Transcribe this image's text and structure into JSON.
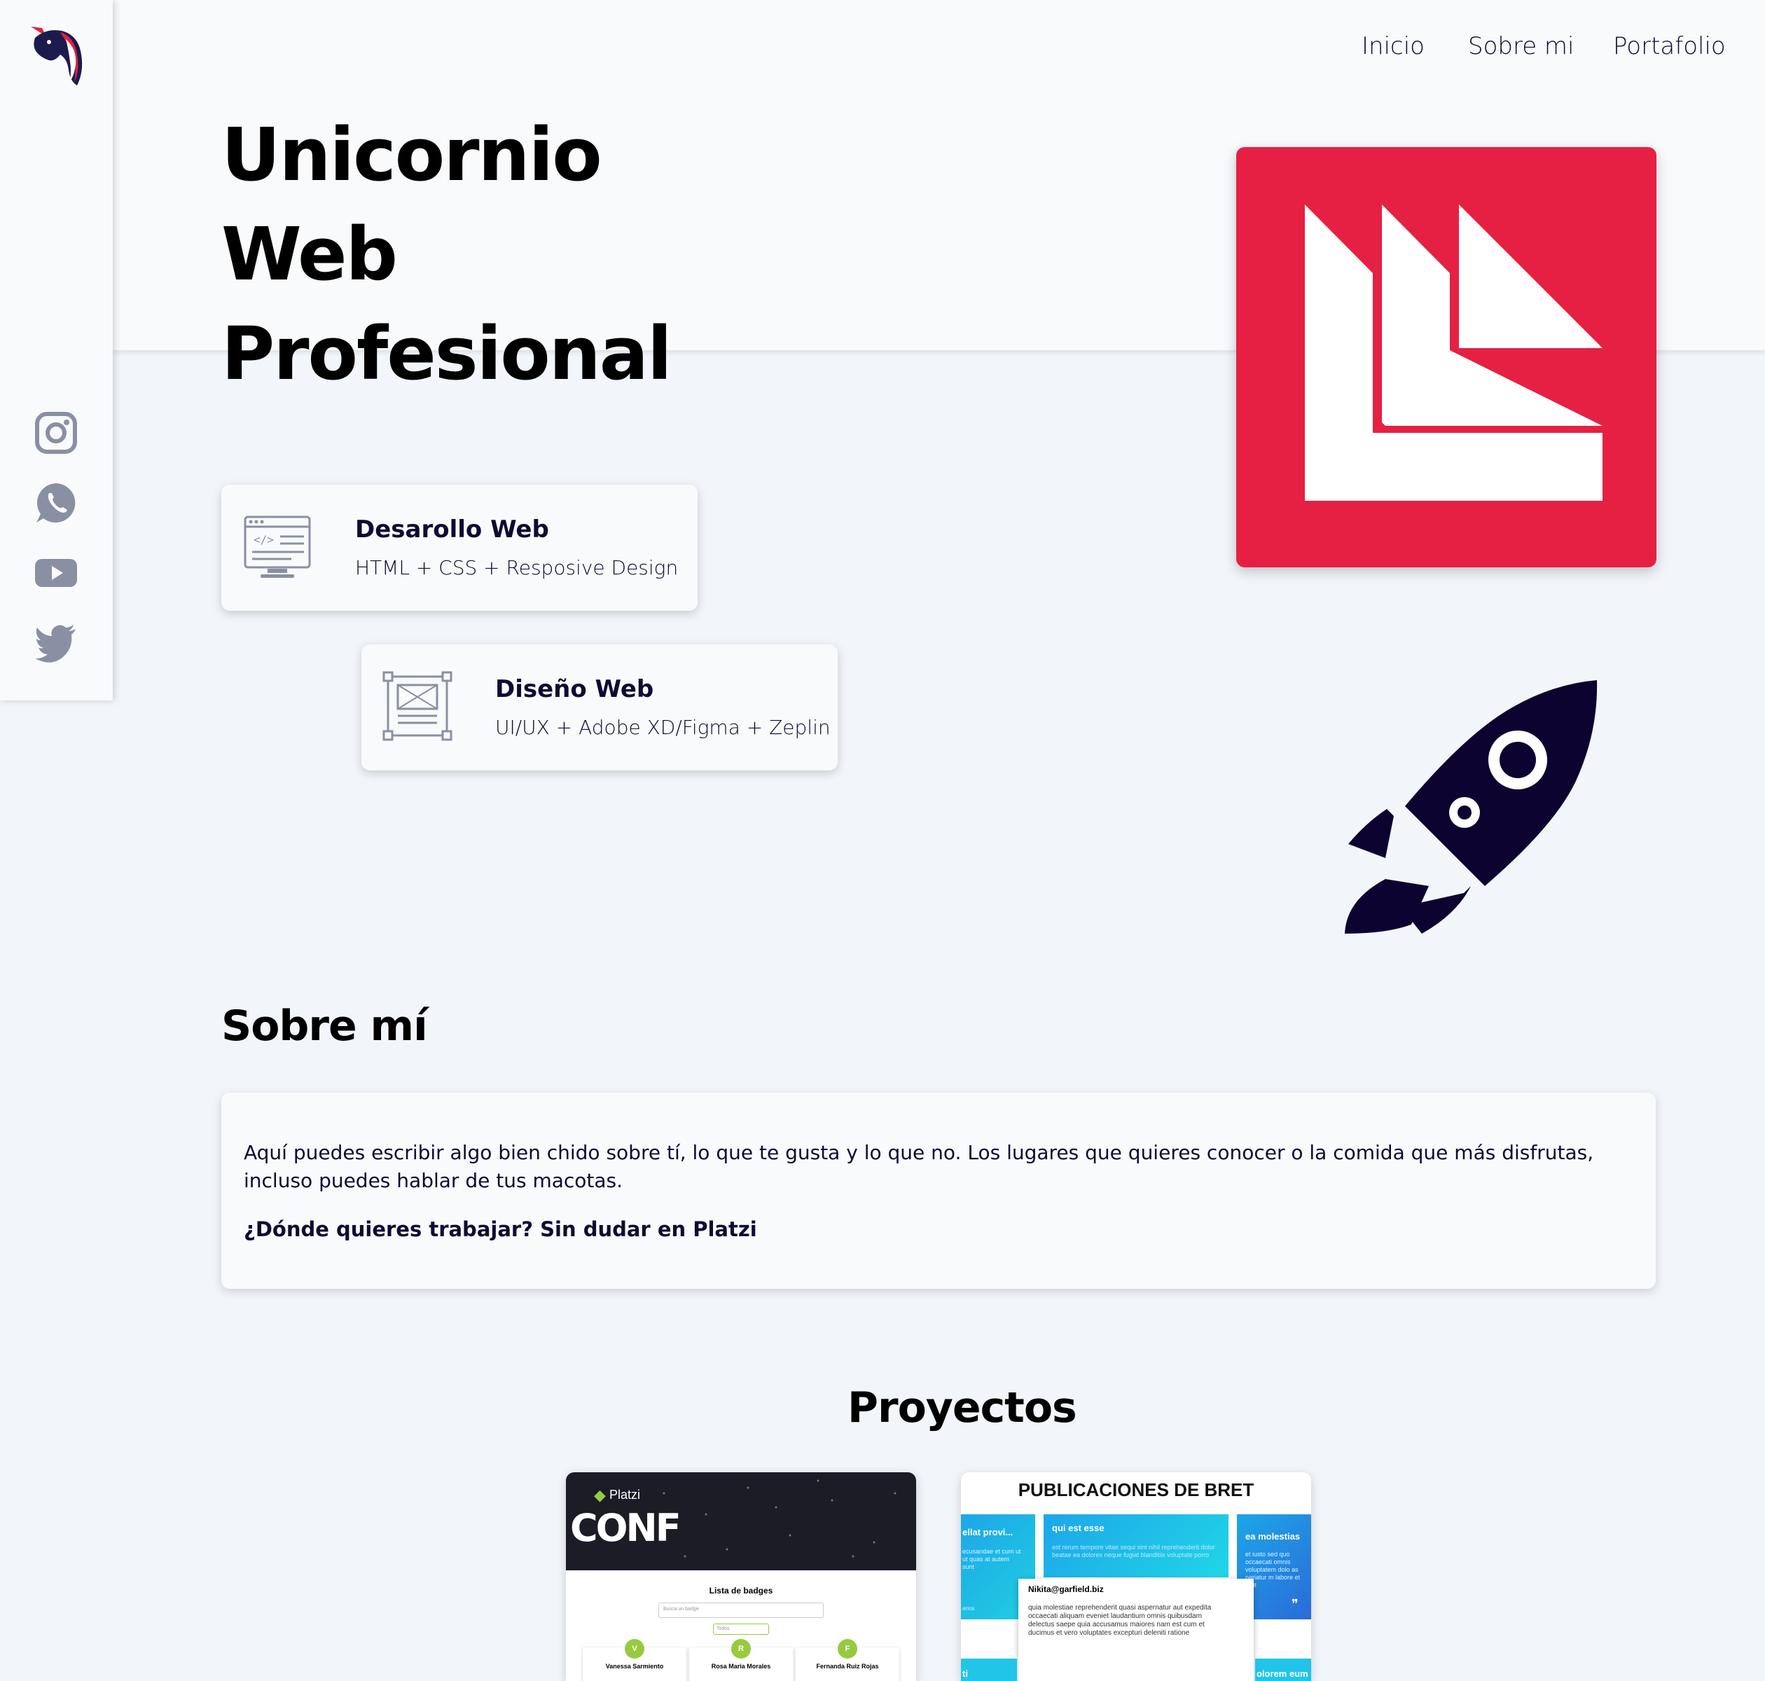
{
  "nav": {
    "items": [
      "Inicio",
      "Sobre mi",
      "Portafolio"
    ]
  },
  "hero": {
    "title_line1": "Unicornio Web",
    "title_line2": "Profesional"
  },
  "social": [
    "instagram-icon",
    "whatsapp-icon",
    "youtube-icon",
    "twitter-icon"
  ],
  "skills": [
    {
      "title": "Desarollo Web",
      "description": "HTML + CSS + Resposive Design",
      "icon": "code-monitor-icon"
    },
    {
      "title": "Diseño Web",
      "description": "UI/UX + Adobe XD/Figma + Zeplin",
      "icon": "wireframe-icon"
    }
  ],
  "about": {
    "title": "Sobre mí",
    "text": "Aquí puedes escribir algo bien chido sobre tí, lo que te gusta y lo que no. Los lugares que quieres conocer o la comida que más disfrutas, incluso puedes hablar de tus macotas.",
    "highlight": "¿Dónde quieres trabajar? Sin dudar en Platzi"
  },
  "projects": {
    "title": "Proyectos",
    "conf": {
      "brand": "Platzi",
      "logo": "CONF",
      "list_title": "Lista de badges",
      "search_placeholder": "Busca un badge",
      "filter": "Todos",
      "people": [
        {
          "initial": "V",
          "name": "Vanessa Sarmiento"
        },
        {
          "initial": "R",
          "name": "Rosa Maria Morales"
        },
        {
          "initial": "F",
          "name": "Fernanda Ruiz Rojas"
        }
      ]
    },
    "bret": {
      "title": "PUBLICACIONES DE BRET",
      "card_left_title": "ellat provi...",
      "card_left_text": "ecusandae et cum ut ut quas at autem sunt",
      "card_left_footer": "arios",
      "card_mid_title": "qui est esse",
      "card_mid_text": "est rerum tempore vitae sequi sint nihil reprehenderit dolor beatae ea dolores neque fugiat blanditiis voluptate porro",
      "card_right_title": "ea molestias",
      "card_right_text": "et iusto sed quo occaecati omnis voluptatem dolo as pariatur m labore et velit",
      "popup_email": "Nikita@garfield.biz",
      "popup_text": "quia molestiae reprehenderit quasi aspernatur aut expedita occaecati aliquam eveniet laudantium omnis quibusdam delectus saepe quia accusamus maiores nam est cum et ducimus et vero voluptates excepturi deleniti ratione",
      "bottom_left": "ti",
      "bottom_right": "olorem eum"
    }
  },
  "colors": {
    "brand_red": "#e62043",
    "navy": "#0d0b33",
    "icon_gray": "#8a90a3"
  }
}
